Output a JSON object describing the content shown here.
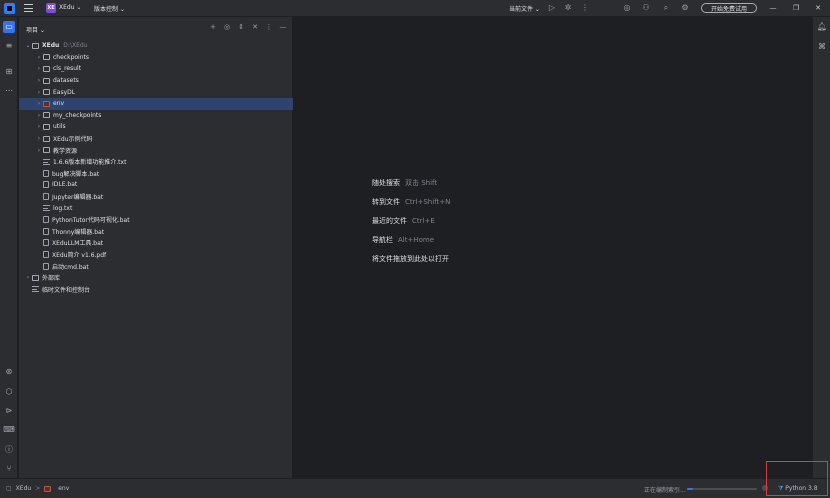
{
  "titlebar": {
    "project_badge": "XE",
    "project_name": "XEdu ⌄",
    "vcs_label": "版本控制 ⌄",
    "current_file_label": "当前文件 ⌄",
    "trial_button": "开始免费试用",
    "icons": [
      "app-logo-icon",
      "hamburger-menu-icon",
      "run-icon",
      "debug-icon",
      "more-icon",
      "ai-assistant-icon",
      "add-user-icon",
      "search-icon",
      "settings-icon",
      "minimize-icon",
      "maximize-icon",
      "close-icon"
    ]
  },
  "project_panel": {
    "title": "项目 ⌄",
    "tree": [
      {
        "label": "XEdu",
        "suffix": "D:\\XEdu",
        "type": "folder",
        "expanded": true,
        "indent": 0
      },
      {
        "label": "checkpoints",
        "type": "folder",
        "indent": 1
      },
      {
        "label": "cls_result",
        "type": "folder",
        "indent": 1
      },
      {
        "label": "datasets",
        "type": "folder",
        "indent": 1
      },
      {
        "label": "EasyDL",
        "type": "folder",
        "indent": 1
      },
      {
        "label": "env",
        "type": "folder-excluded",
        "indent": 1,
        "selected": true
      },
      {
        "label": "my_checkpoints",
        "type": "folder",
        "indent": 1
      },
      {
        "label": "utils",
        "type": "folder",
        "indent": 1
      },
      {
        "label": "XEdu示例代码",
        "type": "folder",
        "indent": 1
      },
      {
        "label": "教学资源",
        "type": "folder",
        "indent": 1
      },
      {
        "label": "1.6.6版本新增功能推介.txt",
        "type": "text",
        "indent": 1
      },
      {
        "label": "bug解决脚本.bat",
        "type": "file",
        "indent": 1
      },
      {
        "label": "IDLE.bat",
        "type": "file",
        "indent": 1
      },
      {
        "label": "Jupyter编辑器.bat",
        "type": "file",
        "indent": 1
      },
      {
        "label": "log.txt",
        "type": "text",
        "indent": 1
      },
      {
        "label": "PythonTutor代码可视化.bat",
        "type": "file",
        "indent": 1
      },
      {
        "label": "Thonny编辑器.bat",
        "type": "file",
        "indent": 1
      },
      {
        "label": "XEduLLM工具.bat",
        "type": "file",
        "indent": 1
      },
      {
        "label": "XEdu简介 v1.6.pdf",
        "type": "file",
        "indent": 1
      },
      {
        "label": "启动cmd.bat",
        "type": "file",
        "indent": 1
      },
      {
        "label": "外部库",
        "type": "library",
        "indent": 0,
        "collapsed": true
      },
      {
        "label": "临时文件和控制台",
        "type": "scratch",
        "indent": 0
      }
    ]
  },
  "editor": {
    "hints": [
      {
        "label": "随处搜索",
        "key": "双击 Shift"
      },
      {
        "label": "转到文件",
        "key": "Ctrl+Shift+N"
      },
      {
        "label": "最近的文件",
        "key": "Ctrl+E"
      },
      {
        "label": "导航栏",
        "key": "Alt+Home"
      },
      {
        "label": "将文件拖放到此处以打开",
        "key": ""
      }
    ]
  },
  "statusbar": {
    "path_root": "XEdu",
    "path_sep": ">",
    "path_leaf": "env",
    "indexing_text": "正在编制索引...",
    "indexing_progress": 0.08,
    "interpreter": "Python 3.8"
  }
}
